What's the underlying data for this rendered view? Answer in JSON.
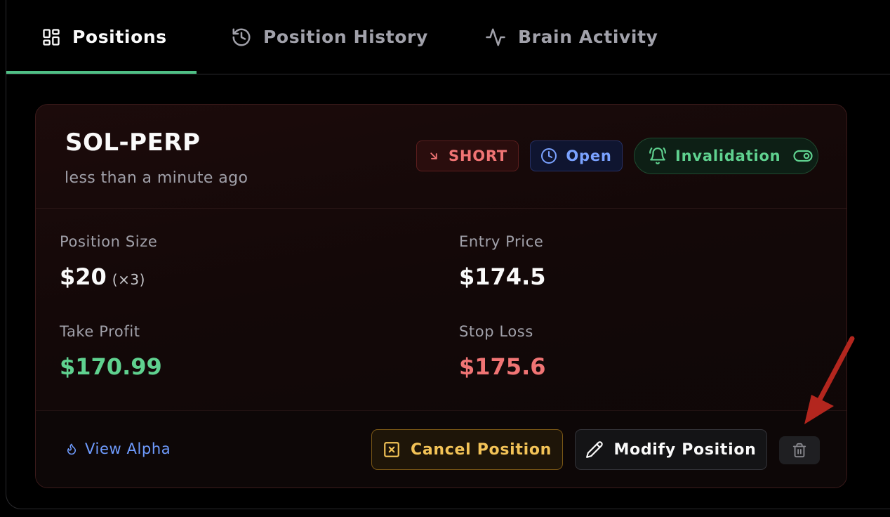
{
  "tabs": [
    {
      "label": "Positions",
      "icon": "grid-icon",
      "active": true
    },
    {
      "label": "Position History",
      "icon": "history-icon",
      "active": false
    },
    {
      "label": "Brain Activity",
      "icon": "activity-icon",
      "active": false
    }
  ],
  "position": {
    "symbol": "SOL-PERP",
    "time_ago": "less than a minute ago",
    "badges": {
      "side": "SHORT",
      "status": "Open",
      "invalidation": "Invalidation"
    },
    "stats": {
      "size_label": "Position Size",
      "size_value": "$20",
      "size_multiplier": "(×3)",
      "entry_label": "Entry Price",
      "entry_value": "$174.5",
      "tp_label": "Take Profit",
      "tp_value": "$170.99",
      "sl_label": "Stop Loss",
      "sl_value": "$175.6"
    },
    "footer": {
      "view_alpha": "View Alpha",
      "cancel": "Cancel Position",
      "modify": "Modify Position"
    }
  },
  "colors": {
    "accent_green": "#5fd18f",
    "accent_red": "#f07474",
    "accent_blue": "#7aa2ff",
    "accent_amber": "#f3c357",
    "annotation_arrow": "#b3261e"
  }
}
